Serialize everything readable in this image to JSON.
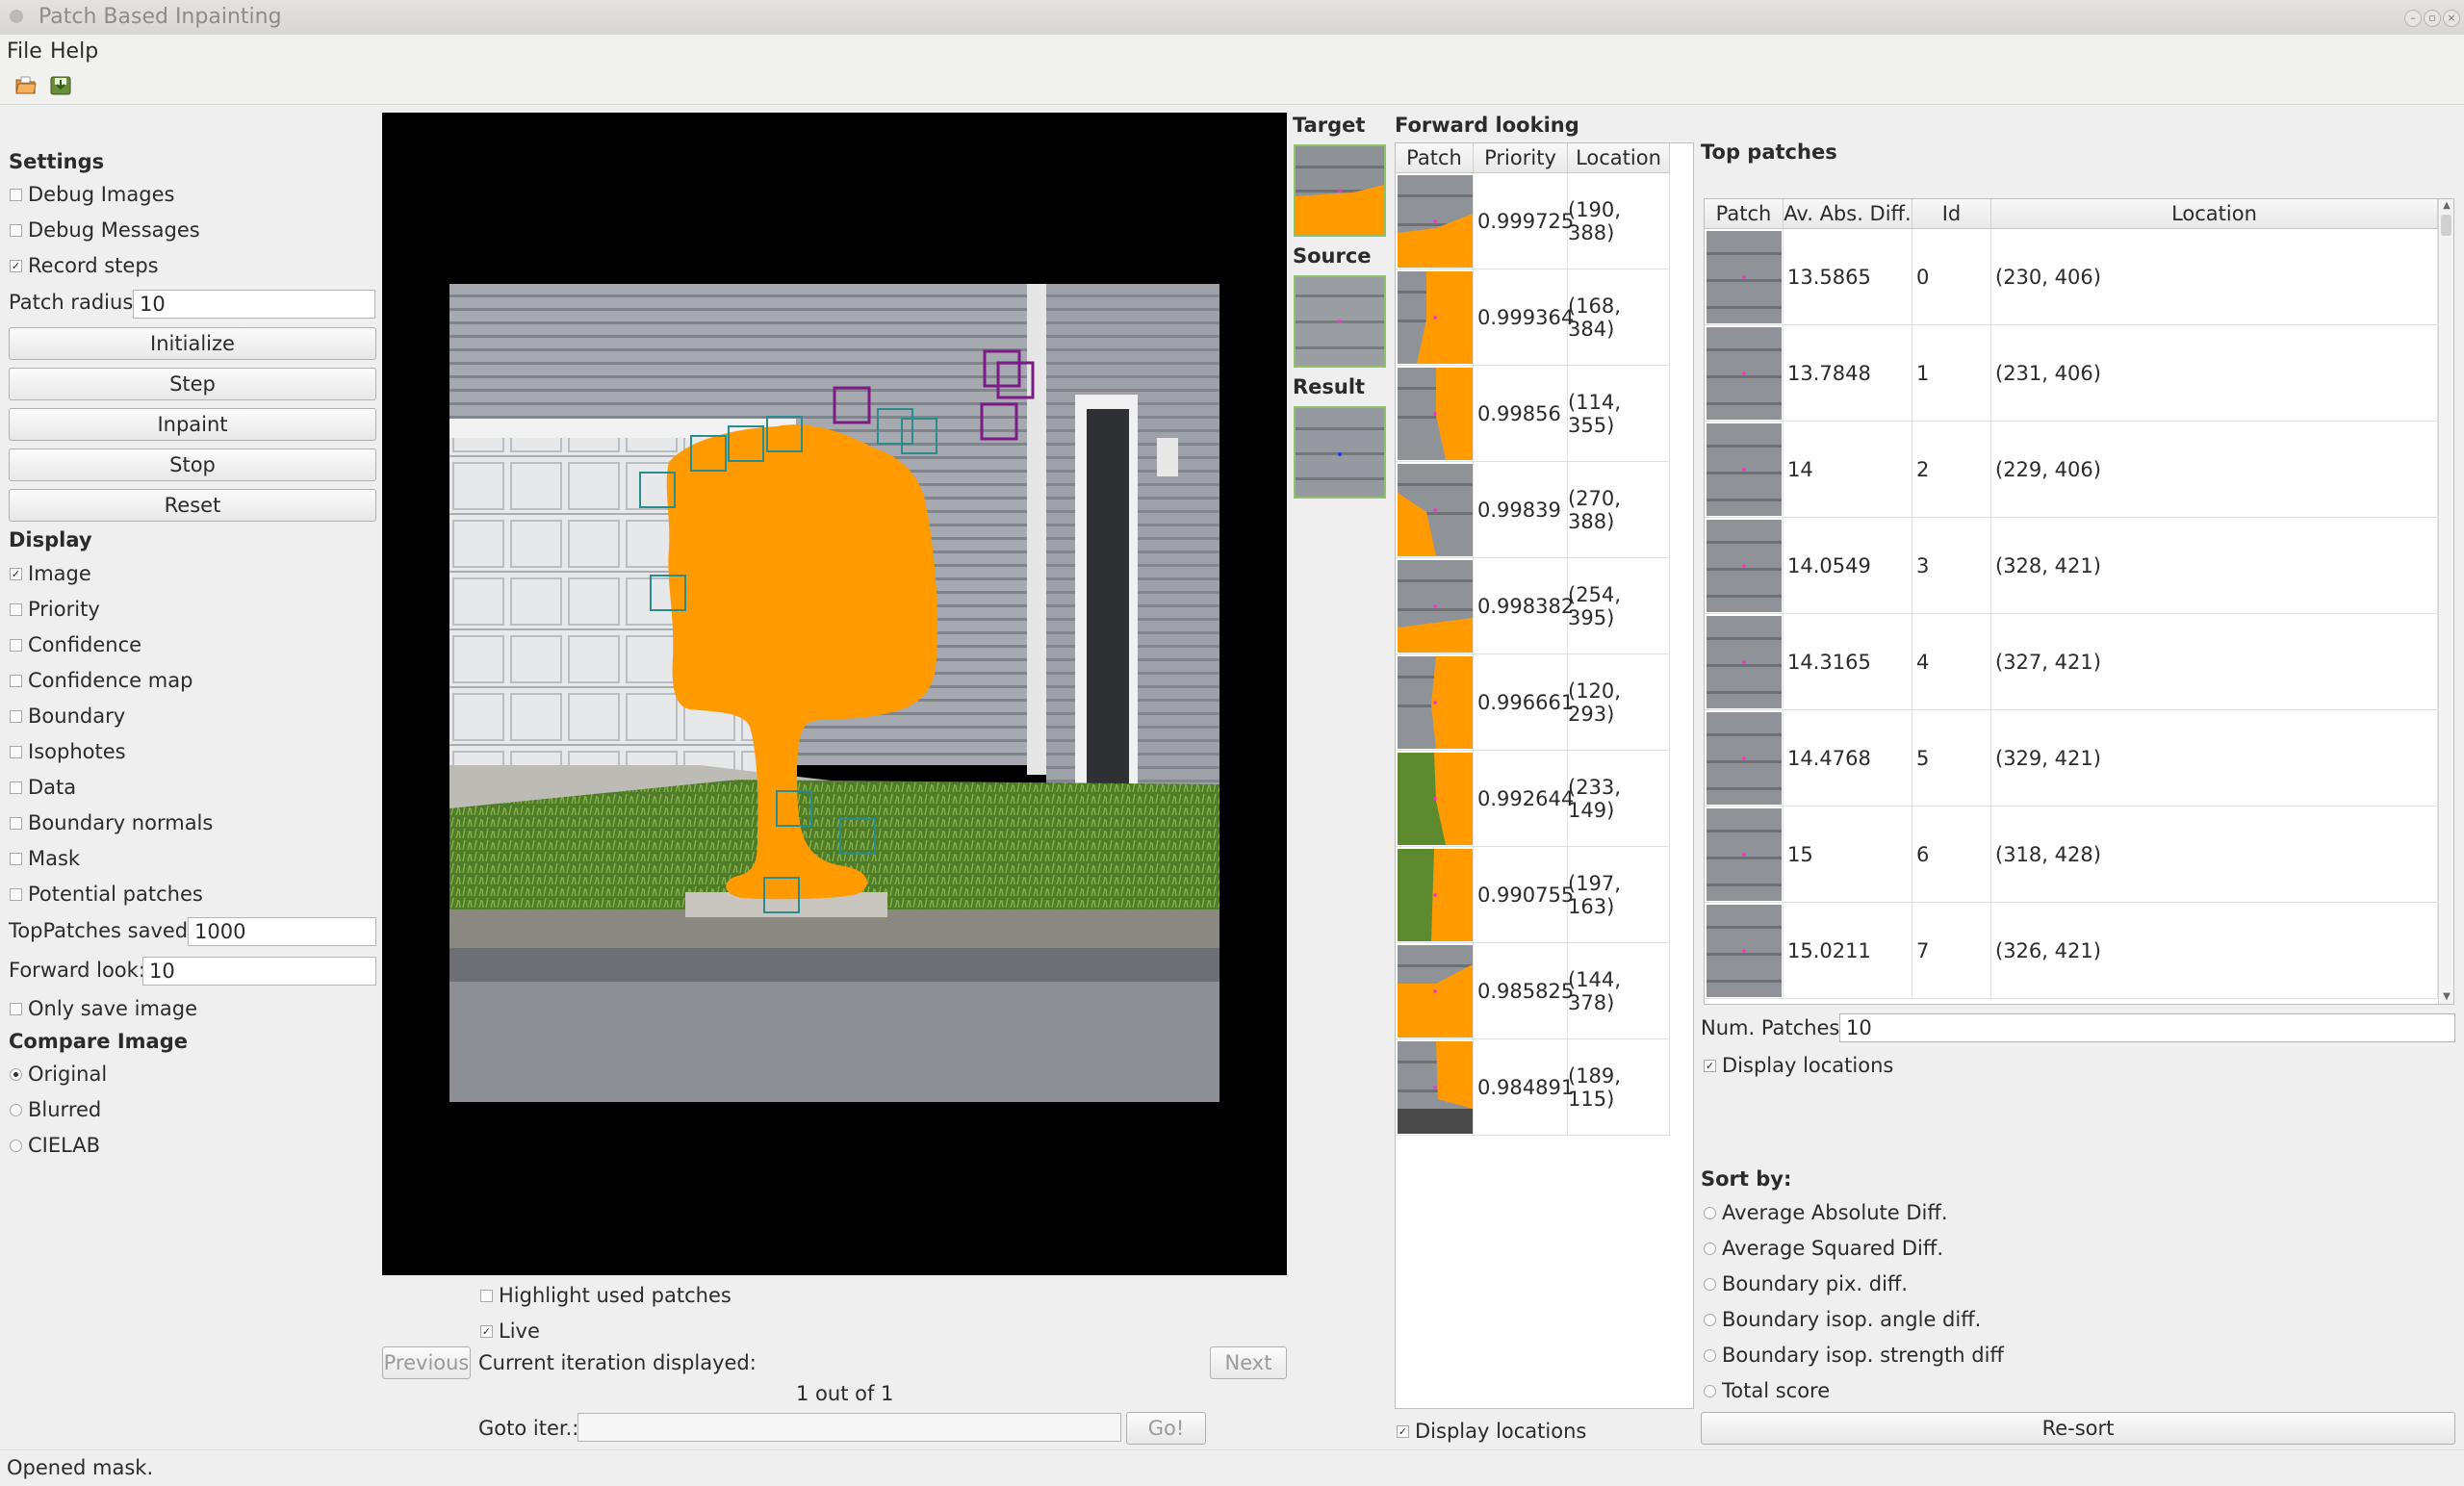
{
  "window": {
    "title": "Patch Based Inpainting"
  },
  "menu": [
    "File",
    "Help"
  ],
  "toolbar": {
    "icons": [
      "open-folder-icon",
      "save-icon"
    ]
  },
  "settings": {
    "title": "Settings",
    "debug_images": {
      "label": "Debug Images",
      "checked": false
    },
    "debug_messages": {
      "label": "Debug Messages",
      "checked": false
    },
    "record_steps": {
      "label": "Record steps",
      "checked": true
    },
    "patch_radius_label": "Patch radius:",
    "patch_radius": "10",
    "buttons": {
      "initialize": "Initialize",
      "step": "Step",
      "inpaint": "Inpaint",
      "stop": "Stop",
      "reset": "Reset"
    }
  },
  "display": {
    "title": "Display",
    "options": [
      {
        "label": "Image",
        "checked": true
      },
      {
        "label": "Priority",
        "checked": false
      },
      {
        "label": "Confidence",
        "checked": false
      },
      {
        "label": "Confidence map",
        "checked": false
      },
      {
        "label": "Boundary",
        "checked": false
      },
      {
        "label": "Isophotes",
        "checked": false
      },
      {
        "label": "Data",
        "checked": false
      },
      {
        "label": "Boundary normals",
        "checked": false
      },
      {
        "label": "Mask",
        "checked": false
      },
      {
        "label": "Potential patches",
        "checked": false
      }
    ],
    "top_patches_saved_label": "TopPatches saved:",
    "top_patches_saved": "1000",
    "forward_look_label": "Forward look:",
    "forward_look": "10",
    "only_save_image": {
      "label": "Only save image",
      "checked": false
    }
  },
  "compare_image": {
    "title": "Compare Image",
    "options": [
      {
        "label": "Original",
        "selected": true
      },
      {
        "label": "Blurred",
        "selected": false
      },
      {
        "label": "CIELAB",
        "selected": false
      }
    ]
  },
  "viewer": {
    "highlight_used_patches": {
      "label": "Highlight used patches",
      "checked": false
    },
    "live": {
      "label": "Live",
      "checked": true
    },
    "previous": "Previous",
    "next": "Next",
    "current_iteration_label": "Current iteration displayed:",
    "iteration_text": "1 out of 1",
    "goto_label": "Goto iter.:",
    "goto_value": "",
    "go": "Go!"
  },
  "patch_preview": {
    "target": "Target",
    "source": "Source",
    "result": "Result"
  },
  "forward_looking": {
    "title": "Forward looking",
    "columns": [
      "Patch",
      "Priority",
      "Location"
    ],
    "rows": [
      {
        "priority": "0.999725",
        "location": "(190, 388)"
      },
      {
        "priority": "0.999364",
        "location": "(168, 384)"
      },
      {
        "priority": "0.99856",
        "location": "(114, 355)"
      },
      {
        "priority": "0.99839",
        "location": "(270, 388)"
      },
      {
        "priority": "0.998382",
        "location": "(254, 395)"
      },
      {
        "priority": "0.996661",
        "location": "(120, 293)"
      },
      {
        "priority": "0.992644",
        "location": "(233, 149)"
      },
      {
        "priority": "0.990755",
        "location": "(197, 163)"
      },
      {
        "priority": "0.985825",
        "location": "(144, 378)"
      },
      {
        "priority": "0.984891",
        "location": "(189, 115)"
      }
    ],
    "display_locations": {
      "label": "Display locations",
      "checked": true
    }
  },
  "top_patches": {
    "title": "Top patches",
    "columns": [
      "Patch",
      "Av. Abs. Diff.",
      "Id",
      "Location"
    ],
    "rows": [
      {
        "diff": "13.5865",
        "id": "0",
        "location": "(230, 406)"
      },
      {
        "diff": "13.7848",
        "id": "1",
        "location": "(231, 406)"
      },
      {
        "diff": "14",
        "id": "2",
        "location": "(229, 406)"
      },
      {
        "diff": "14.0549",
        "id": "3",
        "location": "(328, 421)"
      },
      {
        "diff": "14.3165",
        "id": "4",
        "location": "(327, 421)"
      },
      {
        "diff": "14.4768",
        "id": "5",
        "location": "(329, 421)"
      },
      {
        "diff": "15",
        "id": "6",
        "location": "(318, 428)"
      },
      {
        "diff": "15.0211",
        "id": "7",
        "location": "(326, 421)"
      }
    ],
    "num_patches_label": "Num. Patches:",
    "num_patches": "10",
    "display_locations": {
      "label": "Display locations",
      "checked": true
    },
    "sort_by_title": "Sort by:",
    "sort_options": [
      {
        "label": "Average Absolute Diff.",
        "selected": false
      },
      {
        "label": "Average Squared Diff.",
        "selected": false
      },
      {
        "label": "Boundary pix. diff.",
        "selected": false
      },
      {
        "label": "Boundary isop. angle diff.",
        "selected": false
      },
      {
        "label": "Boundary isop. strength diff",
        "selected": false
      },
      {
        "label": "Total score",
        "selected": false
      }
    ],
    "resort": "Re-sort"
  },
  "status": "Opened mask.",
  "colors": {
    "mask": "#ff9a00",
    "patch_outline": "#2a8c8c",
    "selected_patch_outline": "#7d1b86",
    "thumb_border": "#8fc06a"
  }
}
